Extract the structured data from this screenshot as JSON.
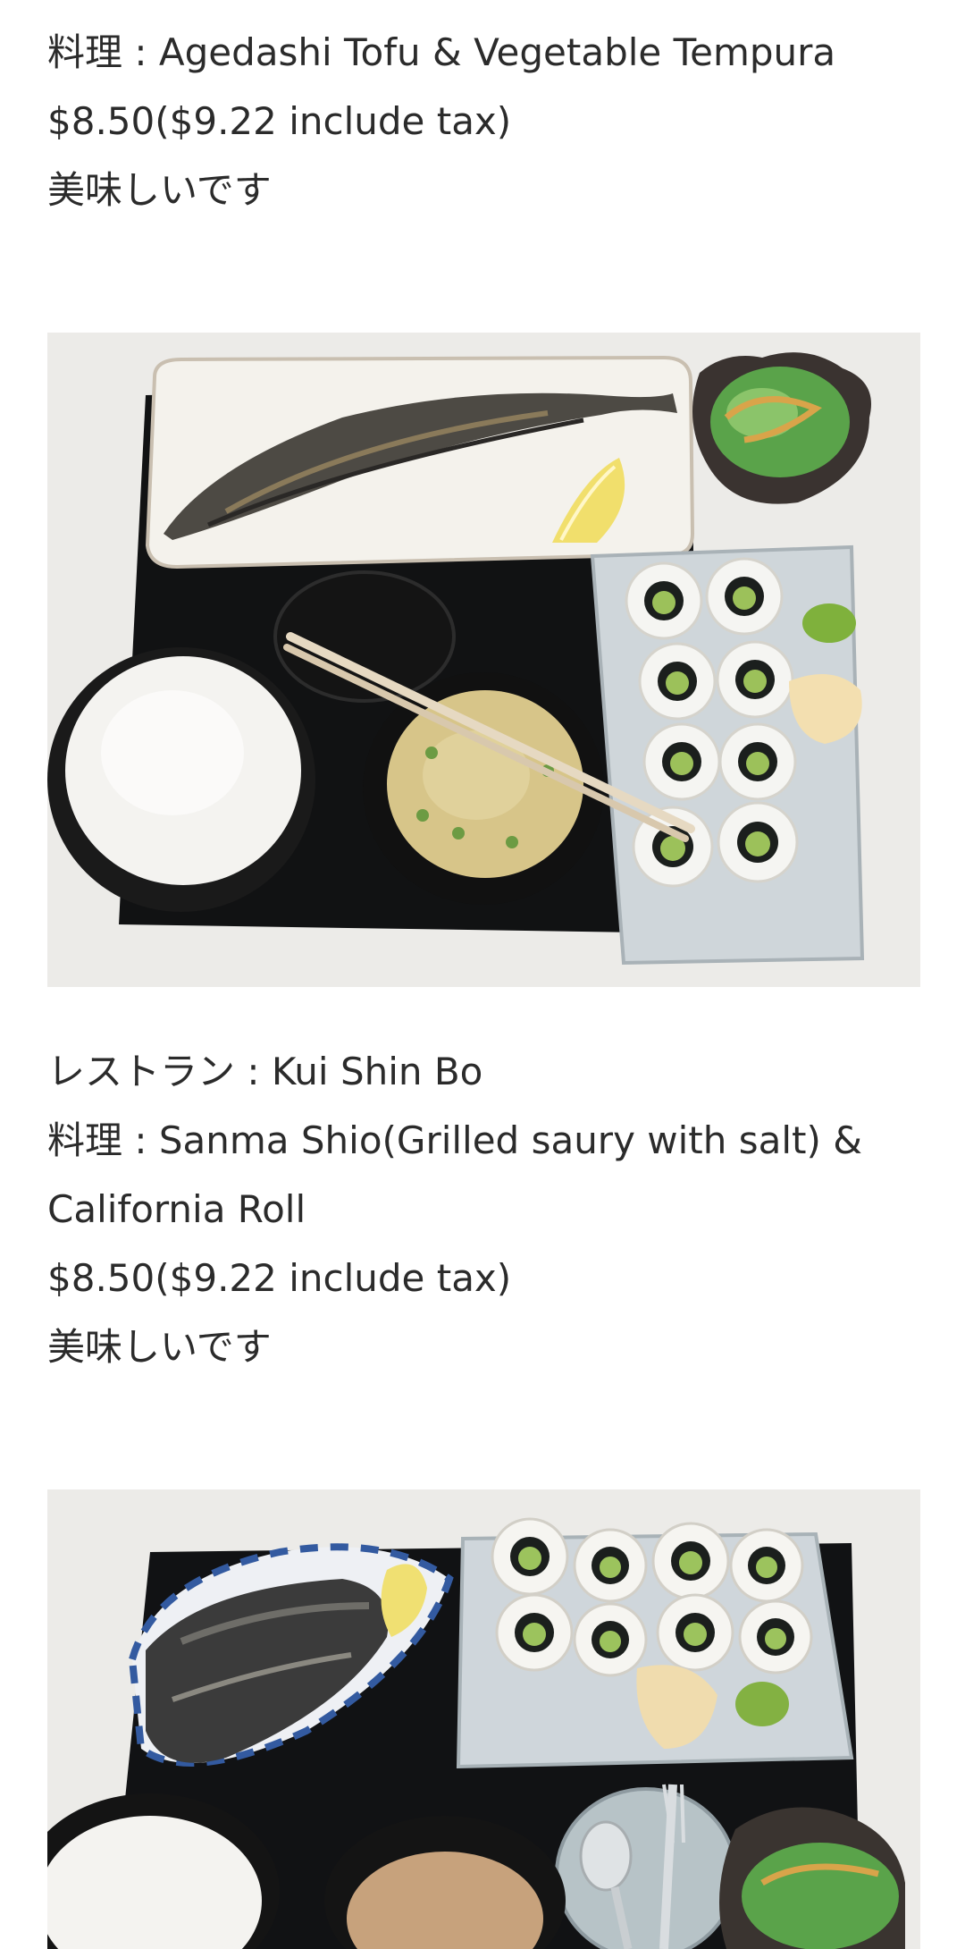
{
  "posts": [
    {
      "dish_line": "料理 : Agedashi Tofu & Vegetable Tempura",
      "price_line": "$8.50($9.22 include tax)",
      "review_line": "美味しいです"
    },
    {
      "restaurant_line": "レストラン : Kui Shin Bo",
      "dish_line": "料理 : Sanma Shio(Grilled saury with salt) & California Roll",
      "price_line": "$8.50($9.22 include tax)",
      "review_line": "美味しいです"
    }
  ],
  "photos": [
    {
      "subject": "Grilled saury set with lemon, salad, California roll, ginger, wasabi, rice, miso soup and chopsticks on a black tray"
    },
    {
      "subject": "Grilled fish set with lemon, California roll, ginger, wasabi, rice, miso soup, salad and spoon & fork on a black tray"
    }
  ]
}
